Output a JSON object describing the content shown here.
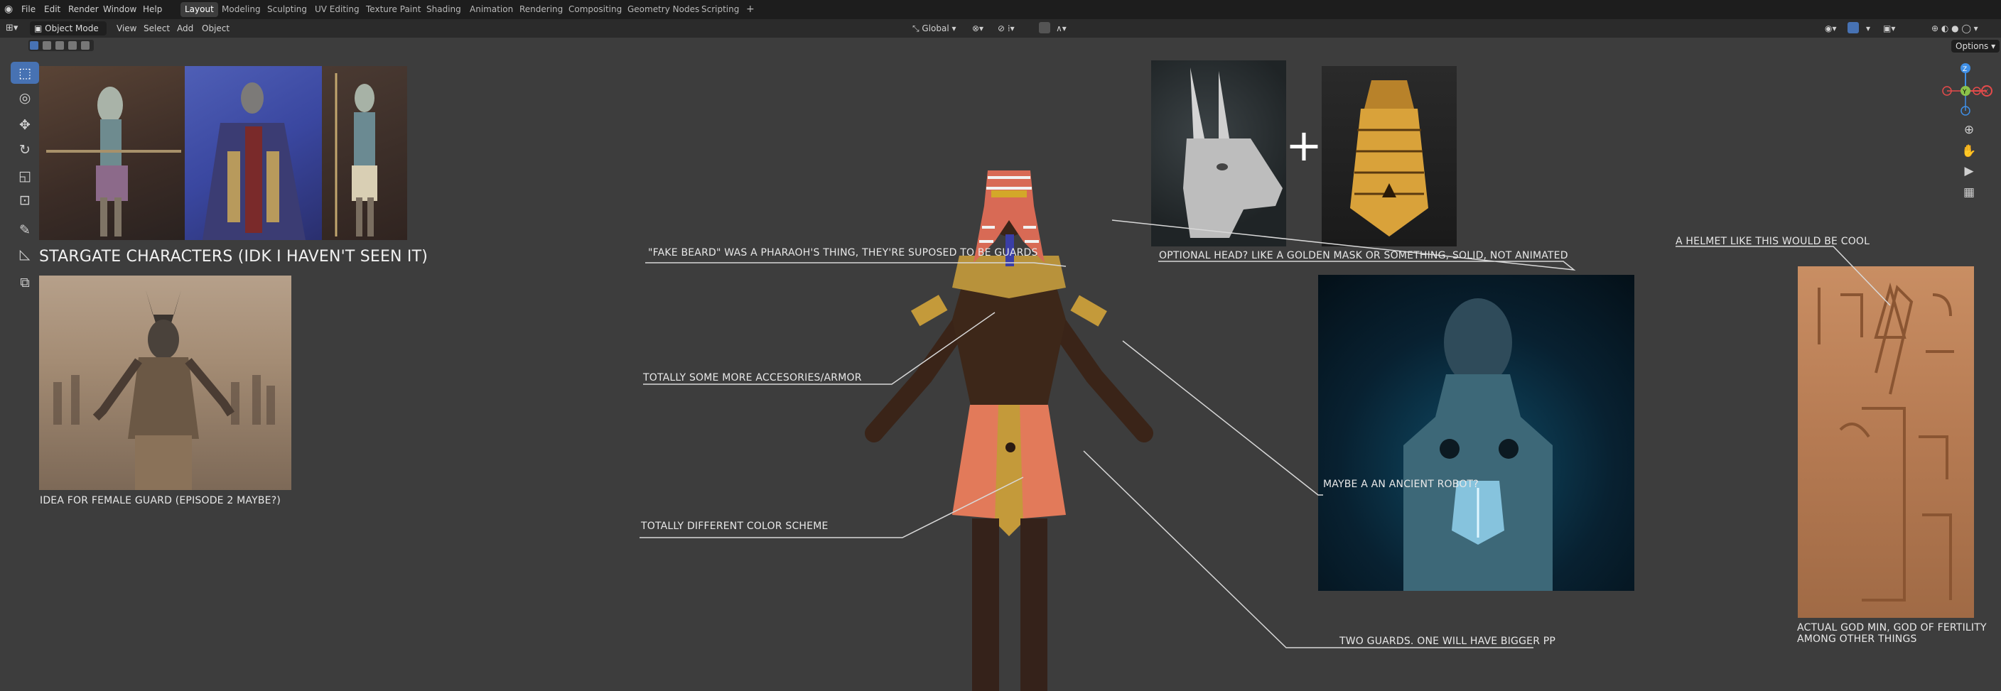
{
  "menubar": {
    "items": [
      "File",
      "Edit",
      "Render",
      "Window",
      "Help"
    ],
    "workspaces": [
      "Layout",
      "Modeling",
      "Sculpting",
      "UV Editing",
      "Texture Paint",
      "Shading",
      "Animation",
      "Rendering",
      "Compositing",
      "Geometry Nodes",
      "Scripting"
    ],
    "active_workspace": "Layout",
    "add_tab": "+"
  },
  "header": {
    "mode": "Object Mode",
    "menus": [
      "View",
      "Select",
      "Add",
      "Object"
    ],
    "orientation": "Global",
    "options": "Options"
  },
  "annotations": {
    "stargate": "STARGATE CHARACTERS (IDK I HAVEN'T SEEN IT)",
    "female_guard": "IDEA FOR FEMALE GUARD (EPISODE 2 MAYBE?)",
    "fake_beard": "\"FAKE BEARD\" WAS A PHARAOH'S THING, THEY'RE SUPOSED TO BE GUARDS",
    "optional_head": "OPTIONAL HEAD? LIKE A GOLDEN MASK OR SOMETHING, SOLID, NOT ANIMATED",
    "accessories": "TOTALLY SOME MORE ACCESORIES/ARMOR",
    "color_scheme": "TOTALLY DIFFERENT COLOR SCHEME",
    "robot": "MAYBE A AN ANCIENT ROBOT?",
    "helmet": "A HELMET LIKE THIS WOULD BE COOL",
    "god_min_line1": "ACTUAL GOD MIN, GOD OF FERTILITY",
    "god_min_line2": "AMONG OTHER THINGS",
    "two_guards": "TWO GUARDS. ONE WILL HAVE BIGGER PP",
    "plus": "+"
  },
  "gizmo": {
    "x": "X",
    "y": "Y",
    "z": "Z"
  },
  "colors": {
    "accent": "#4772b3",
    "axis_x": "#e54b4b",
    "axis_y": "#8bc34a",
    "axis_z": "#3f8fe6"
  },
  "icons": {
    "tools": [
      "select-box-icon",
      "cursor-icon",
      "move-icon",
      "rotate-icon",
      "scale-icon",
      "transform-icon",
      "annotate-icon",
      "measure-icon",
      "add-cube-icon"
    ],
    "nav": [
      "zoom-icon",
      "hand-pan-icon",
      "camera-icon",
      "grid-icon"
    ]
  }
}
